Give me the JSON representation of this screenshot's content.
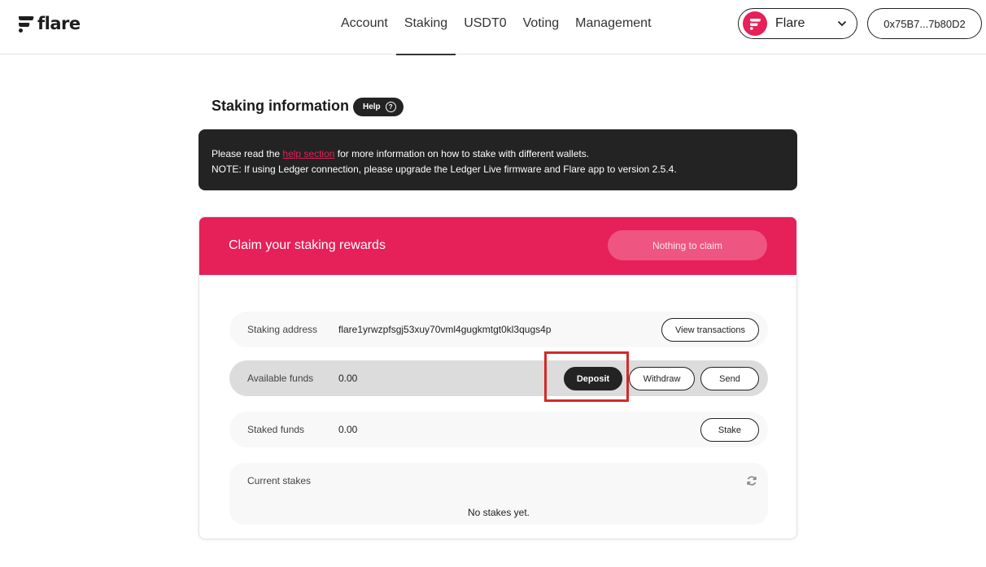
{
  "header": {
    "logo_text": "flare",
    "nav": [
      {
        "label": "Account",
        "active": false
      },
      {
        "label": "Staking",
        "active": true
      },
      {
        "label": "USDT0",
        "active": false
      },
      {
        "label": "Voting",
        "active": false
      },
      {
        "label": "Management",
        "active": false
      }
    ],
    "network": {
      "label": "Flare",
      "icon": "chevron-down-icon"
    },
    "wallet_address": "0x75B7...7b80D2"
  },
  "page": {
    "title": "Staking information",
    "help_label": "Help"
  },
  "notice": {
    "line1_prefix": "Please read the ",
    "line1_link": "help section",
    "line1_suffix": " for more information on how to stake with different wallets.",
    "line2": "NOTE: If using Ledger connection, please upgrade the Ledger Live firmware and Flare app to version 2.5.4."
  },
  "card": {
    "head_title": "Claim your staking rewards",
    "claim_button": "Nothing to claim",
    "staking_address": {
      "label": "Staking address",
      "value": "flare1yrwzpfsgj53xuy70vml4gugkmtgt0kl3qugs4p",
      "button": "View transactions"
    },
    "available_funds": {
      "label": "Available funds",
      "value": "0.00",
      "deposit": "Deposit",
      "withdraw": "Withdraw",
      "send": "Send"
    },
    "staked_funds": {
      "label": "Staked funds",
      "value": "0.00",
      "button": "Stake"
    },
    "current_stakes": {
      "label": "Current stakes",
      "empty": "No stakes yet."
    }
  },
  "colors": {
    "brand": "#e62058",
    "dark": "#232323",
    "highlight_box": "#d42a2a"
  }
}
